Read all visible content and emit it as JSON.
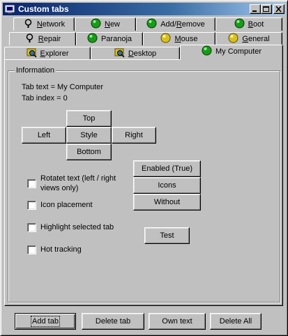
{
  "window": {
    "title": "Custom tabs",
    "minimize_label": "_",
    "maximize_label": "□",
    "close_label": "✕"
  },
  "tabs_row1": [
    {
      "label_prefix": "",
      "accel": "N",
      "label_suffix": "etwork",
      "icon": "network-icon"
    },
    {
      "label_prefix": "",
      "accel": "N",
      "label_suffix": "ew",
      "icon": "green-orb-icon"
    },
    {
      "label_prefix": "Add/",
      "accel": "R",
      "label_suffix": "emove",
      "icon": "green-orb-icon"
    },
    {
      "label_prefix": "",
      "accel": "B",
      "label_suffix": "oot",
      "icon": "green-orb-icon"
    }
  ],
  "tabs_row2": [
    {
      "label_prefix": "",
      "accel": "R",
      "label_suffix": "epair",
      "icon": "network-icon"
    },
    {
      "label_prefix": "Paranoja",
      "accel": "",
      "label_suffix": "",
      "icon": "green-orb-icon"
    },
    {
      "label_prefix": "",
      "accel": "M",
      "label_suffix": "ouse",
      "icon": "yellow-orb-icon"
    },
    {
      "label_prefix": "",
      "accel": "G",
      "label_suffix": "eneral",
      "icon": "yellow-orb-icon"
    }
  ],
  "tabs_row3": [
    {
      "label_prefix": "",
      "accel": "E",
      "label_suffix": "xplorer",
      "icon": "explorer-icon"
    },
    {
      "label_prefix": "",
      "accel": "D",
      "label_suffix": "esktop",
      "icon": "explorer-icon"
    },
    {
      "label_prefix": "My Computer",
      "accel": "",
      "label_suffix": "",
      "icon": "green-orb-icon",
      "active": true
    }
  ],
  "info": {
    "group_title": "Information",
    "tab_text_line": "Tab text =  My Computer",
    "tab_index_line": "Tab index =  0"
  },
  "position_buttons": {
    "top": "Top",
    "left": "Left",
    "style": "Style",
    "right": "Right",
    "bottom": "Bottom"
  },
  "style_buttons": {
    "enabled": "Enabled (True)",
    "icons": "Icons",
    "without": "Without"
  },
  "checkboxes": [
    {
      "label": "Rotatet text (left / right",
      "label2": "views only)",
      "checked": false
    },
    {
      "label": "Icon placement",
      "checked": false
    },
    {
      "label": "Highlight selected tab",
      "checked": false
    },
    {
      "label": "Hot tracking",
      "checked": false
    }
  ],
  "test_button": "Test",
  "bottom_buttons": {
    "add": "Add tab",
    "delete": "Delete tab",
    "own": "Own text",
    "delete_all": "Delete All"
  },
  "colors": {
    "face": "#c0c0c0",
    "titlebar_start": "#0a246a",
    "titlebar_end": "#a6caf0",
    "orb_green": "#1a9a1a",
    "orb_yellow": "#d8c020"
  }
}
